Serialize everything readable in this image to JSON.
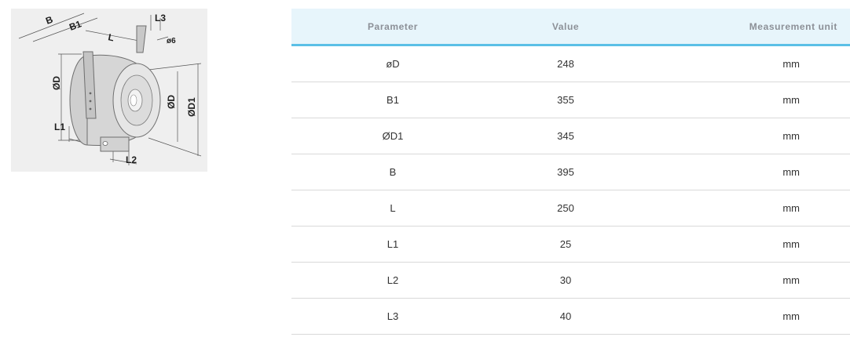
{
  "drawing": {
    "labels": {
      "B": "B",
      "B1": "B1",
      "L": "L",
      "L3": "L3",
      "phi6": "ø6",
      "phiD_left": "ØD",
      "phiD_right": "ØD",
      "phiD1": "ØD1",
      "L1": "L1",
      "L2": "L2"
    }
  },
  "table": {
    "headers": {
      "parameter": "Parameter",
      "value": "Value",
      "unit": "Measurement unit"
    },
    "rows": [
      {
        "parameter": "øD",
        "value": "248",
        "unit": "mm"
      },
      {
        "parameter": "B1",
        "value": "355",
        "unit": "mm"
      },
      {
        "parameter": "ØD1",
        "value": "345",
        "unit": "mm"
      },
      {
        "parameter": "B",
        "value": "395",
        "unit": "mm"
      },
      {
        "parameter": "L",
        "value": "250",
        "unit": "mm"
      },
      {
        "parameter": "L1",
        "value": "25",
        "unit": "mm"
      },
      {
        "parameter": "L2",
        "value": "30",
        "unit": "mm"
      },
      {
        "parameter": "L3",
        "value": "40",
        "unit": "mm"
      }
    ]
  },
  "colors": {
    "header_background": "#e7f5fb",
    "header_underline": "#5bc0e6",
    "header_text": "#8c9097",
    "row_divider": "#d9d9d9",
    "drawing_background": "#efefef"
  }
}
